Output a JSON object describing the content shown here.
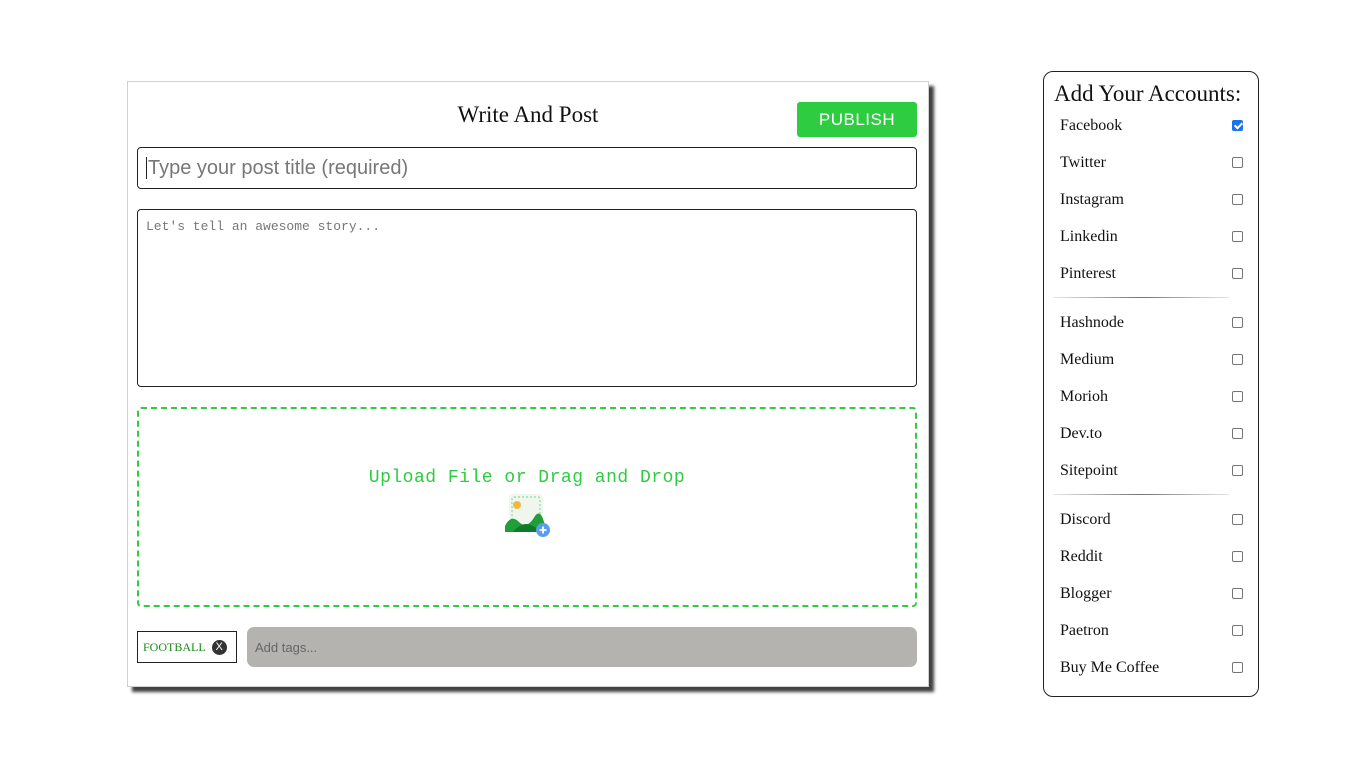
{
  "editor": {
    "title": "Write And Post",
    "publish_label": "PUBLISH",
    "title_placeholder": "Type your post title (required)",
    "story_placeholder": "Let's tell an awesome story...",
    "upload_label": "Upload File or Drag and Drop",
    "upload_icon": "image-add-icon",
    "tags": [
      {
        "label": "FOOTBALL",
        "remove_symbol": "X"
      }
    ],
    "tags_placeholder": "Add tags..."
  },
  "accounts": {
    "title": "Add Your Accounts:",
    "groups": [
      [
        {
          "label": "Facebook",
          "checked": true
        },
        {
          "label": "Twitter",
          "checked": false
        },
        {
          "label": "Instagram",
          "checked": false
        },
        {
          "label": "Linkedin",
          "checked": false
        },
        {
          "label": "Pinterest",
          "checked": false
        }
      ],
      [
        {
          "label": "Hashnode",
          "checked": false
        },
        {
          "label": "Medium",
          "checked": false
        },
        {
          "label": "Morioh",
          "checked": false
        },
        {
          "label": "Dev.to",
          "checked": false
        },
        {
          "label": "Sitepoint",
          "checked": false
        }
      ],
      [
        {
          "label": "Discord",
          "checked": false
        },
        {
          "label": "Reddit",
          "checked": false
        },
        {
          "label": "Blogger",
          "checked": false
        },
        {
          "label": "Paetron",
          "checked": false
        },
        {
          "label": "Buy Me Coffee",
          "checked": false
        }
      ]
    ]
  },
  "colors": {
    "accent_green": "#2ecc40",
    "tags_bg": "#b4b3b0",
    "checkbox_checked": "#1a73e8"
  }
}
